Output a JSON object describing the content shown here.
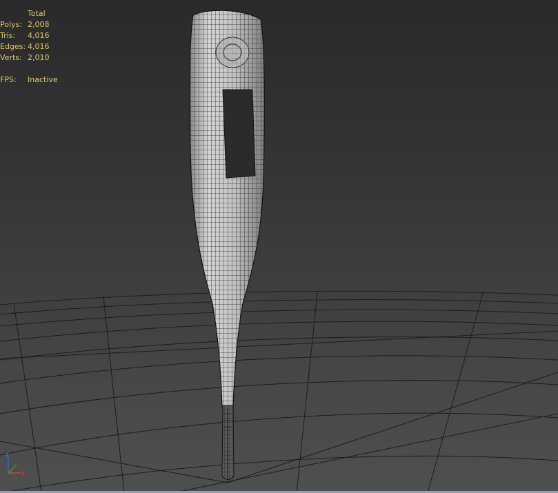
{
  "viewport": {
    "name": "Perspective viewport",
    "object": "digital thermometer wireframe model",
    "colors": {
      "background_top": "#2a2a2a",
      "background_bottom": "#4f4f4f",
      "grid": "#1c1c1c",
      "stats_text": "#e0c86a",
      "mesh_shell": "#c8c8c8",
      "mesh_wire": "#2a2a2a",
      "screen": "#2b2b2b"
    }
  },
  "stats": {
    "header": "Total",
    "polys_label": "Polys:",
    "polys_value": "2,008",
    "tris_label": "Tris:",
    "tris_value": "4,016",
    "edges_label": "Edges:",
    "edges_value": "4,016",
    "verts_label": "Verts:",
    "verts_value": "2,010",
    "fps_label": "FPS:",
    "fps_value": "Inactive"
  },
  "axis_gizmo": {
    "x_label": "x",
    "y_label": "y",
    "z_label": "z",
    "x_color": "#d04040",
    "y_color": "#40a040",
    "z_color": "#4060d0"
  }
}
